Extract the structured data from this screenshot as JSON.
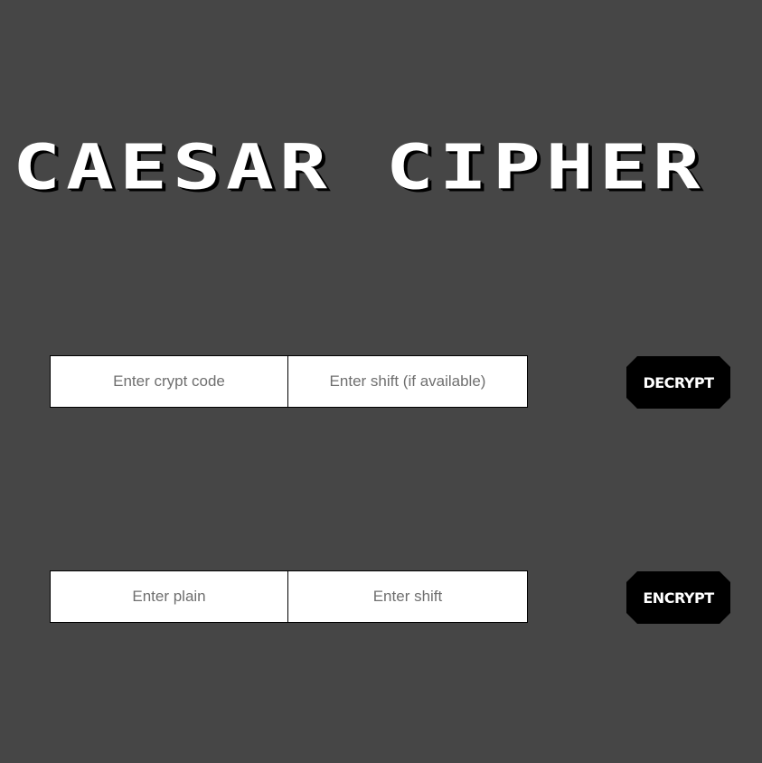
{
  "header": {
    "title": "CAESAR CIPHER"
  },
  "decrypt": {
    "code_placeholder": "Enter crypt code",
    "code_value": "",
    "shift_placeholder": "Enter shift (if available)",
    "shift_value": "",
    "button_label": "DECRYPT"
  },
  "encrypt": {
    "plain_placeholder": "Enter plain",
    "plain_value": "",
    "shift_placeholder": "Enter shift",
    "shift_value": "",
    "button_label": "ENCRYPT"
  },
  "colors": {
    "background": "#464646",
    "title": "#ffffff",
    "button_background": "#000000",
    "button_text": "#ffffff",
    "field_background": "#ffffff"
  }
}
